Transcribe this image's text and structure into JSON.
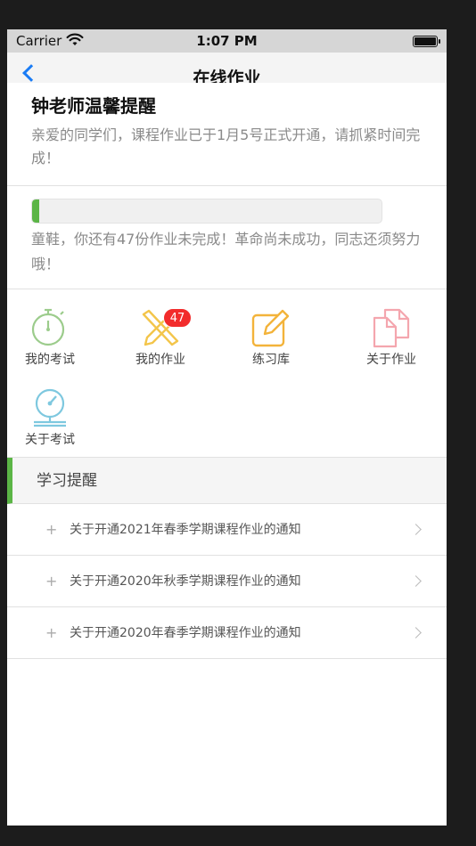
{
  "status": {
    "carrier": "Carrier",
    "time": "1:07 PM"
  },
  "nav": {
    "title": "在线作业"
  },
  "notice": {
    "title": "钟老师温馨提醒",
    "text": "亲爱的同学们，课程作业已于1月5号正式开通，请抓紧时间完成！"
  },
  "progress": {
    "percent": 2,
    "text": "童鞋，你还有47份作业未完成！革命尚未成功，同志还须努力哦！",
    "color": "#5bb546"
  },
  "grid": {
    "items": [
      {
        "label": "我的考试",
        "icon": "stopwatch-icon"
      },
      {
        "label": "我的作业",
        "icon": "pencil-ruler-icon",
        "badge": "47"
      },
      {
        "label": "练习库",
        "icon": "edit-icon"
      },
      {
        "label": "关于作业",
        "icon": "documents-icon"
      },
      {
        "label": "关于考试",
        "icon": "gauge-icon"
      }
    ]
  },
  "reminder": {
    "header": "学习提醒",
    "items": [
      "关于开通2021年春季学期课程作业的通知",
      "关于开通2020年秋季学期课程作业的通知",
      "关于开通2020年春季学期课程作业的通知"
    ]
  },
  "colors": {
    "accent": "#5bb546",
    "badge": "#f22c2c",
    "link": "#1a7cf5"
  }
}
